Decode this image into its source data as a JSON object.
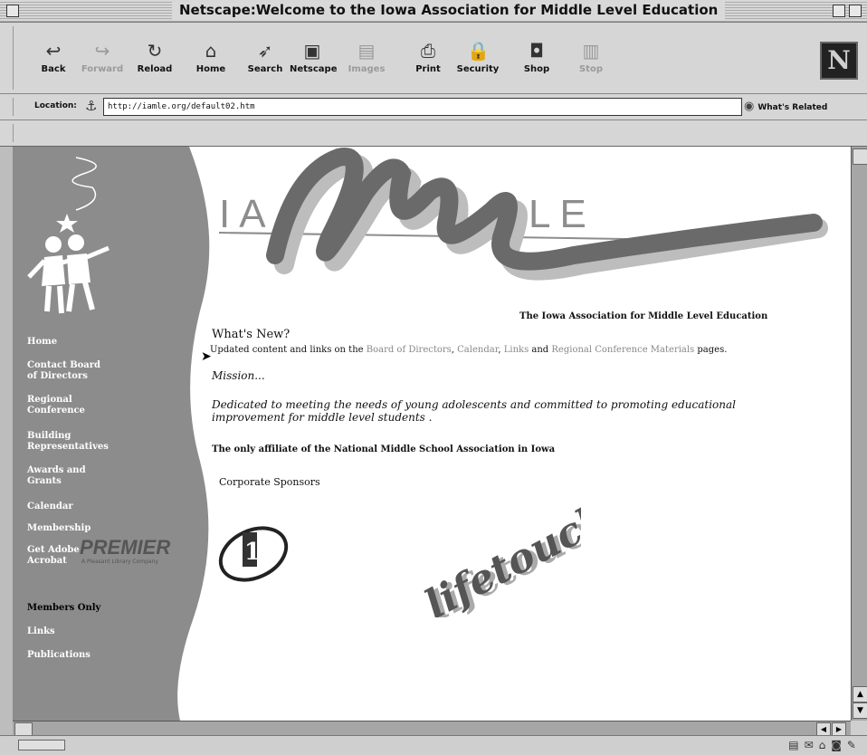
{
  "window": {
    "title": "Netscape:Welcome to the Iowa Association for Middle Level Education"
  },
  "toolbar": {
    "buttons": [
      {
        "label": "Back",
        "icon": "back-icon",
        "glyph": "↩",
        "enabled": true
      },
      {
        "label": "Forward",
        "icon": "forward-icon",
        "glyph": "↪",
        "enabled": false
      },
      {
        "label": "Reload",
        "icon": "reload-icon",
        "glyph": "↻",
        "enabled": true
      },
      {
        "label": "Home",
        "icon": "home-icon",
        "glyph": "⌂",
        "enabled": true
      },
      {
        "label": "Search",
        "icon": "search-icon",
        "glyph": "➶",
        "enabled": true
      },
      {
        "label": "Netscape",
        "icon": "netscape-icon",
        "glyph": "▣",
        "enabled": true
      },
      {
        "label": "Images",
        "icon": "images-icon",
        "glyph": "▤",
        "enabled": false
      },
      {
        "label": "Print",
        "icon": "print-icon",
        "glyph": "⎙",
        "enabled": true
      },
      {
        "label": "Security",
        "icon": "security-icon",
        "glyph": "🔒",
        "enabled": true
      },
      {
        "label": "Shop",
        "icon": "shop-icon",
        "glyph": "◘",
        "enabled": true
      },
      {
        "label": "Stop",
        "icon": "stop-icon",
        "glyph": "▥",
        "enabled": false
      }
    ],
    "logo": "N"
  },
  "location": {
    "label": "Location:",
    "url": "http://iamle.org/default02.htm",
    "whats_related": "What's Related"
  },
  "sidebar": {
    "nav": [
      {
        "lines": [
          "Home"
        ],
        "dark": false
      },
      {
        "lines": [
          "Contact Board",
          "of Directors"
        ],
        "dark": false
      },
      {
        "lines": [
          "Regional",
          "Conference"
        ],
        "dark": false
      },
      {
        "lines": [
          "Building",
          "Representatives"
        ],
        "dark": false
      },
      {
        "lines": [
          "Awards and",
          "Grants"
        ],
        "dark": false
      },
      {
        "lines": [
          "Calendar"
        ],
        "dark": false
      },
      {
        "lines": [
          "Membership"
        ],
        "dark": false
      },
      {
        "lines": [
          "Get Adobe",
          "Acrobat"
        ],
        "dark": false
      },
      {
        "lines": [
          "Members Only"
        ],
        "dark": true
      },
      {
        "lines": [
          "Links"
        ],
        "dark": false
      },
      {
        "lines": [
          "Publications"
        ],
        "dark": false
      }
    ]
  },
  "banner": {
    "left_letters": "IA",
    "right_letters": "LE",
    "tagline": "The Iowa Association for Middle Level Education"
  },
  "main": {
    "whats_new": "What's New?",
    "updated_prefix": "Updated content and links on the ",
    "updated_links": [
      "Board of Directors",
      "Calendar",
      "Links",
      "Regional Conference Materials"
    ],
    "updated_suffix": " pages.",
    "mission": "Mission...",
    "dedicated": "Dedicated to meeting the  needs of young adolescents and committed to promoting educational improvement for middle level students .",
    "affiliate": "The only affiliate of the National Middle School Association in Iowa",
    "sponsors_heading": "Corporate Sponsors",
    "premier": "PREMIER",
    "premier_sub": "A Pleasant Library Company",
    "lifetouch": "lifetouch."
  },
  "colors": {
    "sidebar": "#8c8c8c",
    "chrome": "#d6d6d6",
    "link_gray": "#888888"
  }
}
